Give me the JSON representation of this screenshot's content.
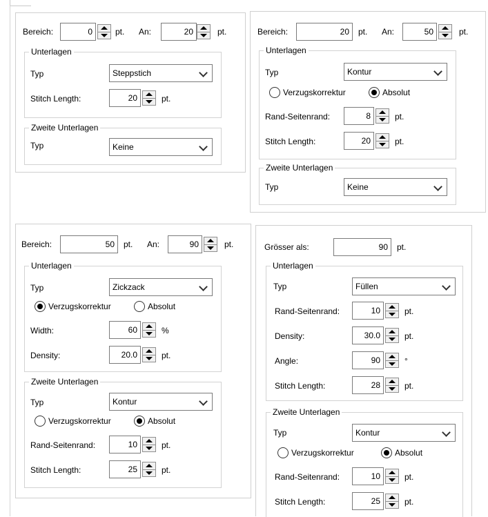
{
  "panel1": {
    "bereich_label": "Bereich:",
    "bereich_value": "0",
    "unit_pt": "pt.",
    "an_label": "An:",
    "an_value": "20",
    "an_unit": "pt.",
    "unterlagen": {
      "legend": "Unterlagen",
      "typ_label": "Typ",
      "typ_value": "Steppstich",
      "stitch_label": "Stitch Length:",
      "stitch_value": "20",
      "stitch_unit": "pt."
    },
    "zweite": {
      "legend": "Zweite Unterlagen",
      "typ_label": "Typ",
      "typ_value": "Keine"
    }
  },
  "panel2": {
    "bereich_label": "Bereich:",
    "bereich_value": "20",
    "unit_pt": "pt.",
    "an_label": "An:",
    "an_value": "50",
    "an_unit": "pt.",
    "unterlagen": {
      "legend": "Unterlagen",
      "typ_label": "Typ",
      "typ_value": "Kontur",
      "radio_a": "Verzugskorrektur",
      "radio_b": "Absolut",
      "selected": "Absolut",
      "rand_label": "Rand-Seitenrand:",
      "rand_value": "8",
      "rand_unit": "pt.",
      "stitch_label": "Stitch Length:",
      "stitch_value": "20",
      "stitch_unit": "pt."
    },
    "zweite": {
      "legend": "Zweite Unterlagen",
      "typ_label": "Typ",
      "typ_value": "Keine"
    }
  },
  "panel3": {
    "bereich_label": "Bereich:",
    "bereich_value": "50",
    "unit_pt": "pt.",
    "an_label": "An:",
    "an_value": "90",
    "an_unit": "pt.",
    "unterlagen": {
      "legend": "Unterlagen",
      "typ_label": "Typ",
      "typ_value": "Zickzack",
      "radio_a": "Verzugskorrektur",
      "radio_b": "Absolut",
      "selected": "Verzugskorrektur",
      "width_label": "Width:",
      "width_value": "60",
      "width_unit": "%",
      "density_label": "Density:",
      "density_value": "20.0",
      "density_unit": "pt."
    },
    "zweite": {
      "legend": "Zweite Unterlagen",
      "typ_label": "Typ",
      "typ_value": "Kontur",
      "radio_a": "Verzugskorrektur",
      "radio_b": "Absolut",
      "selected": "Absolut",
      "rand_label": "Rand-Seitenrand:",
      "rand_value": "10",
      "rand_unit": "pt.",
      "stitch_label": "Stitch Length:",
      "stitch_value": "25",
      "stitch_unit": "pt."
    }
  },
  "panel4": {
    "groesser_label": "Grösser als:",
    "groesser_value": "90",
    "groesser_unit": "pt.",
    "unterlagen": {
      "legend": "Unterlagen",
      "typ_label": "Typ",
      "typ_value": "Füllen",
      "rand_label": "Rand-Seitenrand:",
      "rand_value": "10",
      "rand_unit": "pt.",
      "density_label": "Density:",
      "density_value": "30.0",
      "density_unit": "pt.",
      "angle_label": "Angle:",
      "angle_value": "90",
      "angle_unit": "°",
      "stitch_label": "Stitch Length:",
      "stitch_value": "28",
      "stitch_unit": "pt."
    },
    "zweite": {
      "legend": "Zweite Unterlagen",
      "typ_label": "Typ",
      "typ_value": "Kontur",
      "radio_a": "Verzugskorrektur",
      "radio_b": "Absolut",
      "selected": "Absolut",
      "rand_label": "Rand-Seitenrand:",
      "rand_value": "10",
      "rand_unit": "pt.",
      "stitch_label": "Stitch Length:",
      "stitch_value": "25",
      "stitch_unit": "pt."
    }
  },
  "icons": {
    "spin_up": "caret-up-icon",
    "spin_down": "caret-down-icon",
    "dropdown": "chevron-down-icon"
  }
}
